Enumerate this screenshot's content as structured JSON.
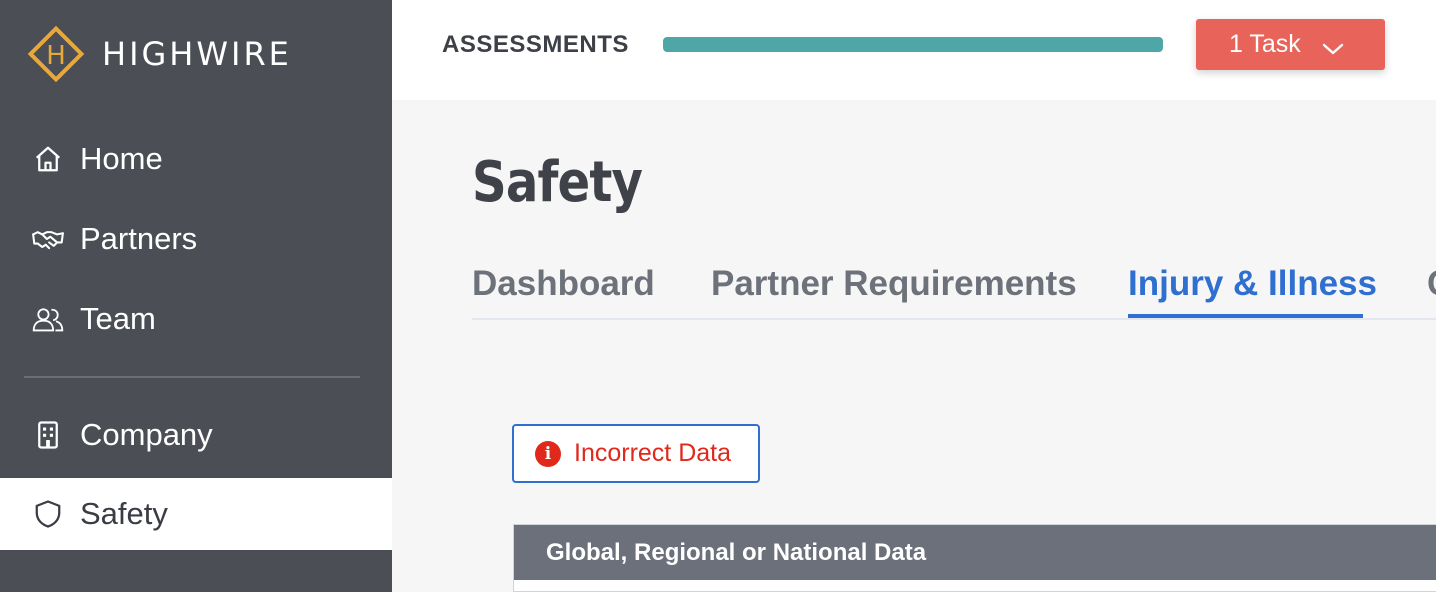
{
  "sidebar": {
    "brand": "HIGHWIRE",
    "brand_letter": "H",
    "items": [
      {
        "label": "Home",
        "icon": "home-icon"
      },
      {
        "label": "Partners",
        "icon": "handshake-icon"
      },
      {
        "label": "Team",
        "icon": "team-icon"
      },
      {
        "label": "Company",
        "icon": "building-icon"
      },
      {
        "label": "Safety",
        "icon": "shield-icon",
        "active": true
      }
    ]
  },
  "topbar": {
    "assessments_label": "ASSESSMENTS",
    "progress_fraction": 1.0,
    "task_button_label": "1 Task"
  },
  "main": {
    "title": "Safety",
    "tabs": [
      {
        "label": "Dashboard"
      },
      {
        "label": "Partner Requirements"
      },
      {
        "label": "Injury & Illness",
        "active": true
      },
      {
        "label": "C"
      }
    ],
    "incorrect_data_label": "Incorrect Data",
    "section_header": "Global, Regional or National Data"
  },
  "colors": {
    "sidebar_bg": "#4b4e55",
    "accent_blue": "#2f6fd0",
    "task_red": "#e8645a",
    "progress_teal": "#4ea6a6",
    "logo_gold": "#e8a93a",
    "alert_red": "#e0281b"
  }
}
